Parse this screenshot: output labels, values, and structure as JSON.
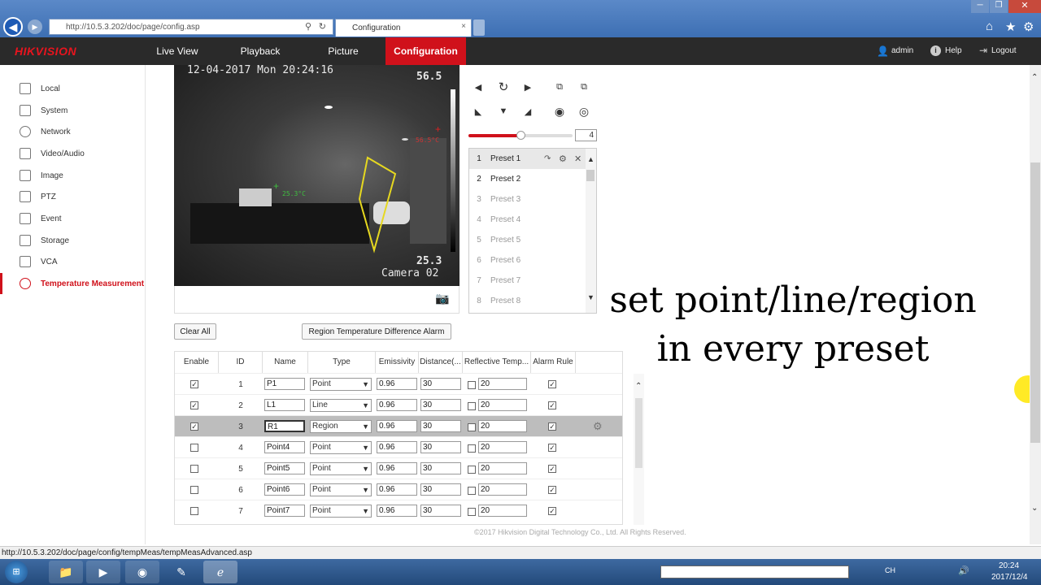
{
  "browser": {
    "url": "http://10.5.3.202/doc/page/config.asp",
    "tab_title": "Configuration"
  },
  "nav": {
    "brand": "HIKVISION",
    "items": [
      "Live View",
      "Playback",
      "Picture",
      "Configuration"
    ],
    "user": "admin",
    "help": "Help",
    "logout": "Logout"
  },
  "sidebar": {
    "items": [
      "Local",
      "System",
      "Network",
      "Video/Audio",
      "Image",
      "PTZ",
      "Event",
      "Storage",
      "VCA",
      "Temperature Measurement"
    ]
  },
  "video": {
    "timestamp": "12-04-2017 Mon 20:24:16",
    "max_temp": "56.5",
    "min_temp": "25.3",
    "camera_label": "Camera 02",
    "point_temp": "25.3°C",
    "hot_temp": "56.5°C"
  },
  "ptz": {
    "zoom_value": "4",
    "slider_level": 0.5
  },
  "presets": [
    {
      "num": "1",
      "name": "Preset 1"
    },
    {
      "num": "2",
      "name": "Preset 2"
    },
    {
      "num": "3",
      "name": "Preset 3"
    },
    {
      "num": "4",
      "name": "Preset 4"
    },
    {
      "num": "5",
      "name": "Preset 5"
    },
    {
      "num": "6",
      "name": "Preset 6"
    },
    {
      "num": "7",
      "name": "Preset 7"
    },
    {
      "num": "8",
      "name": "Preset 8"
    }
  ],
  "buttons": {
    "clear_all": "Clear All",
    "region_alarm": "Region Temperature Difference Alarm"
  },
  "table": {
    "headers": [
      "Enable",
      "ID",
      "Name",
      "Type",
      "Emissivity",
      "Distance(...",
      "Reflective Temp...",
      "Alarm Rule"
    ],
    "rows": [
      {
        "enable": true,
        "id": "1",
        "name": "P1",
        "type": "Point",
        "emissivity": "0.96",
        "distance": "30",
        "refl_on": false,
        "refl": "20",
        "alarm": true
      },
      {
        "enable": true,
        "id": "2",
        "name": "L1",
        "type": "Line",
        "emissivity": "0.96",
        "distance": "30",
        "refl_on": false,
        "refl": "20",
        "alarm": true
      },
      {
        "enable": true,
        "id": "3",
        "name": "R1",
        "type": "Region",
        "emissivity": "0.96",
        "distance": "30",
        "refl_on": false,
        "refl": "20",
        "alarm": true
      },
      {
        "enable": false,
        "id": "4",
        "name": "Point4",
        "type": "Point",
        "emissivity": "0.96",
        "distance": "30",
        "refl_on": false,
        "refl": "20",
        "alarm": true
      },
      {
        "enable": false,
        "id": "5",
        "name": "Point5",
        "type": "Point",
        "emissivity": "0.96",
        "distance": "30",
        "refl_on": false,
        "refl": "20",
        "alarm": true
      },
      {
        "enable": false,
        "id": "6",
        "name": "Point6",
        "type": "Point",
        "emissivity": "0.96",
        "distance": "30",
        "refl_on": false,
        "refl": "20",
        "alarm": true
      },
      {
        "enable": false,
        "id": "7",
        "name": "Point7",
        "type": "Point",
        "emissivity": "0.96",
        "distance": "30",
        "refl_on": false,
        "refl": "20",
        "alarm": true
      }
    ]
  },
  "overlay": {
    "line1": "set point/line/region",
    "line2": "in every preset"
  },
  "footer": {
    "copyright": "©2017 Hikvision Digital Technology Co., Ltd. All Rights Reserved."
  },
  "status": {
    "url": "http://10.5.3.202/doc/page/config/tempMeas/tempMeasAdvanced.asp"
  },
  "taskbar": {
    "time": "20:24",
    "date": "2017/12/4",
    "lang": "CH"
  },
  "colors": {
    "accent": "#d0111b",
    "nav_bg": "#2a2a2a"
  }
}
